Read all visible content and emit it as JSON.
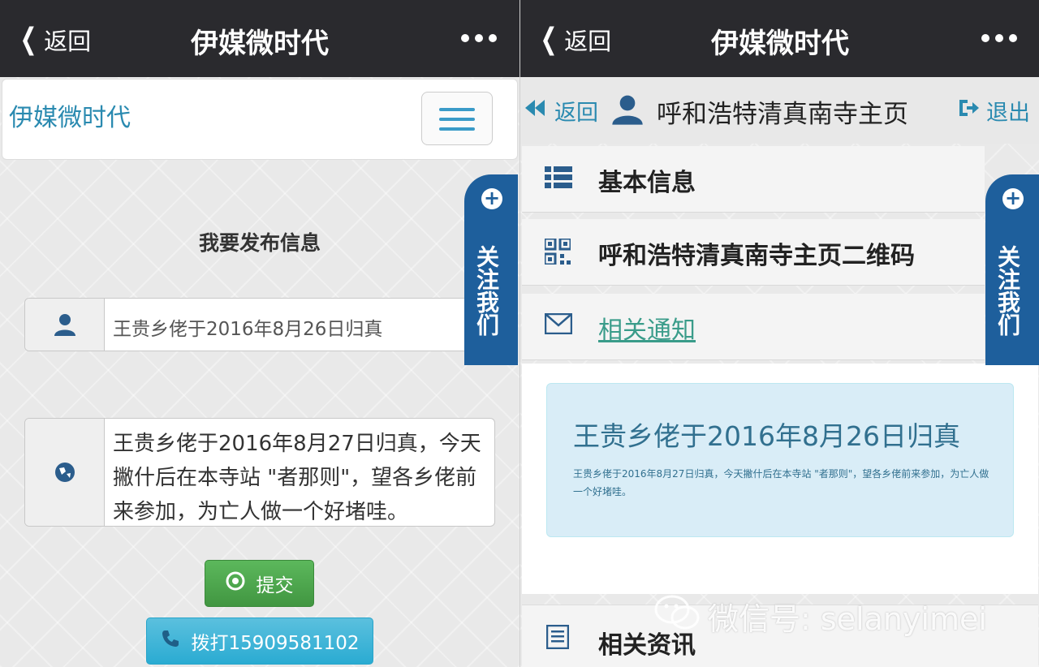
{
  "left": {
    "topbar": {
      "back_label": "返回",
      "title": "伊媒微时代"
    },
    "brand": "伊媒微时代",
    "heading": "我要发布信息",
    "title_field": {
      "value": "王贵乡佬于2016年8月26日归真"
    },
    "content_field": {
      "value": "王贵乡佬于2016年8月27日归真，今天撇什后在本寺站 \"者那则\"，望各乡佬前来参加，为亡人做一个好堵哇。"
    },
    "submit_label": "提交",
    "call_label": "拨打15909581102",
    "follow_text": "关注我们"
  },
  "right": {
    "topbar": {
      "back_label": "返回",
      "title": "伊媒微时代"
    },
    "nav": {
      "back_label": "返回",
      "title": "呼和浩特清真南寺主页",
      "exit_label": "退出"
    },
    "menu": [
      {
        "label": "基本信息",
        "icon": "list-icon"
      },
      {
        "label": "呼和浩特清真南寺主页二维码",
        "icon": "qrcode-icon"
      },
      {
        "label": "相关通知",
        "icon": "envelope-icon"
      }
    ],
    "notice": {
      "title": "王贵乡佬于2016年8月26日归真",
      "body": "王贵乡佬于2016年8月27日归真，今天撇什后在本寺站 \"者那则\"，望各乡佬前来参加，为亡人做一个好堵哇。"
    },
    "news_label": "相关资讯",
    "follow_text": "关注我们"
  },
  "watermark": "微信号: selanyimei",
  "colors": {
    "topbar": "#2a2a2e",
    "accent": "#2a8ab0",
    "follow": "#1e5f9c",
    "submit": "#5cb85c",
    "call": "#5bc0de",
    "notice_bg": "#d9edf7"
  }
}
